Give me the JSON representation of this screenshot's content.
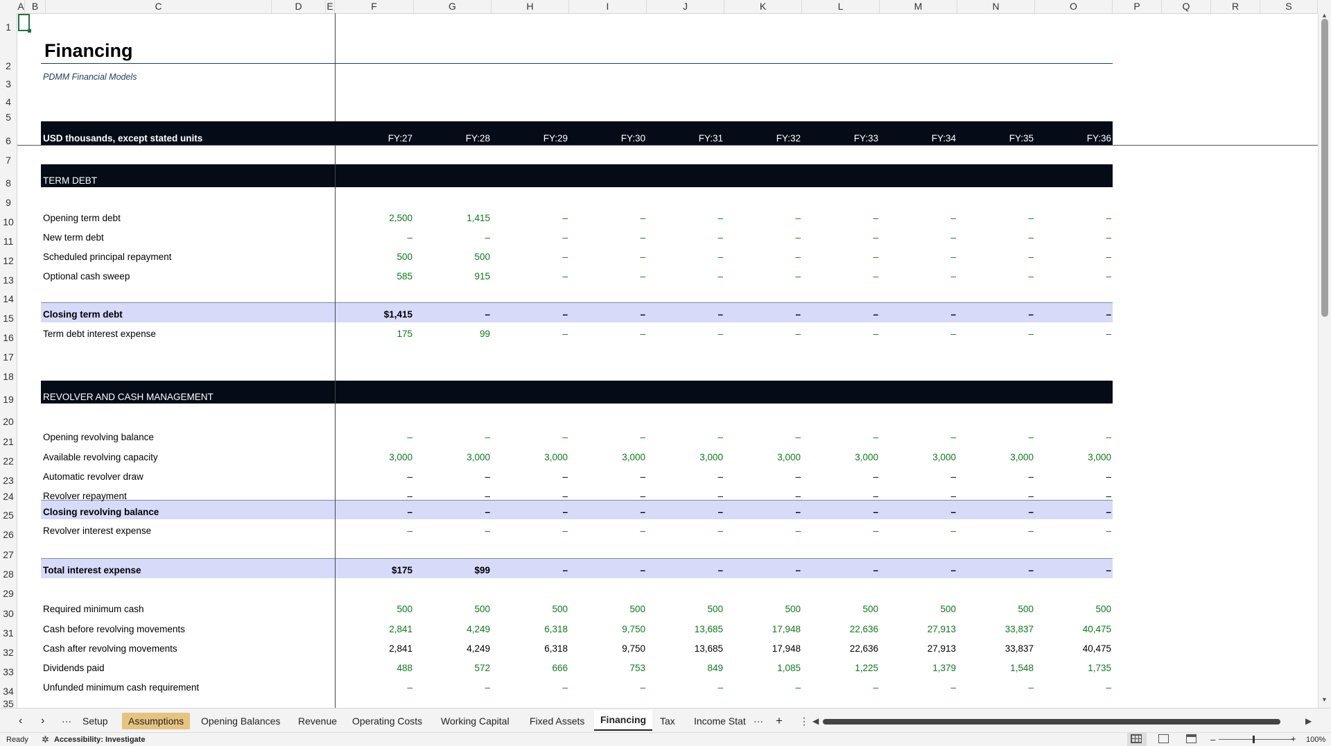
{
  "columns": [
    "A",
    "B",
    "C",
    "D",
    "E",
    "F",
    "G",
    "H",
    "I",
    "J",
    "K",
    "L",
    "M",
    "N",
    "O",
    "P",
    "Q",
    "R",
    "S"
  ],
  "rows": [
    "1",
    "2",
    "3",
    "4",
    "5",
    "6",
    "7",
    "8",
    "9",
    "10",
    "11",
    "12",
    "13",
    "14",
    "15",
    "16",
    "17",
    "18",
    "19",
    "20",
    "21",
    "22",
    "23",
    "24",
    "25",
    "26",
    "27",
    "28",
    "29",
    "30",
    "31",
    "32",
    "33",
    "34",
    "35"
  ],
  "sheet": {
    "title": "Financing",
    "subtitle": "PDMM Financial Models",
    "units_label": "USD thousands, except stated units",
    "periods": [
      "FY:27",
      "FY:28",
      "FY:29",
      "FY:30",
      "FY:31",
      "FY:32",
      "FY:33",
      "FY:34",
      "FY:35",
      "FY:36"
    ],
    "sections": {
      "term_debt": "TERM DEBT",
      "revolver": "REVOLVER AND CASH MANAGEMENT"
    },
    "lines": [
      {
        "label": "Opening term debt",
        "values": [
          "2,500",
          "1,415",
          "–",
          "–",
          "–",
          "–",
          "–",
          "–",
          "–",
          "–"
        ]
      },
      {
        "label": "New term debt",
        "values": [
          "–",
          "–",
          "–",
          "–",
          "–",
          "–",
          "–",
          "–",
          "–",
          "–"
        ]
      },
      {
        "label": "Scheduled principal repayment",
        "values": [
          "500",
          "500",
          "–",
          "–",
          "–",
          "–",
          "–",
          "–",
          "–",
          "–"
        ]
      },
      {
        "label": "Optional cash sweep",
        "values": [
          "585",
          "915",
          "–",
          "–",
          "–",
          "–",
          "–",
          "–",
          "–",
          "–"
        ]
      },
      {
        "label": "Closing term debt",
        "values": [
          "$1,415",
          "–",
          "–",
          "–",
          "–",
          "–",
          "–",
          "–",
          "–",
          "–"
        ]
      },
      {
        "label": "Term debt interest expense",
        "values": [
          "175",
          "99",
          "–",
          "–",
          "–",
          "–",
          "–",
          "–",
          "–",
          "–"
        ]
      },
      {
        "label": "Opening revolving balance",
        "values": [
          "–",
          "–",
          "–",
          "–",
          "–",
          "–",
          "–",
          "–",
          "–",
          "–"
        ]
      },
      {
        "label": "Available revolving capacity",
        "values": [
          "3,000",
          "3,000",
          "3,000",
          "3,000",
          "3,000",
          "3,000",
          "3,000",
          "3,000",
          "3,000",
          "3,000"
        ]
      },
      {
        "label": "Automatic revolver draw",
        "values": [
          "–",
          "–",
          "–",
          "–",
          "–",
          "–",
          "–",
          "–",
          "–",
          "–"
        ]
      },
      {
        "label": "Revolver repayment",
        "values": [
          "–",
          "–",
          "–",
          "–",
          "–",
          "–",
          "–",
          "–",
          "–",
          "–"
        ]
      },
      {
        "label": "Closing revolving balance",
        "values": [
          "–",
          "–",
          "–",
          "–",
          "–",
          "–",
          "–",
          "–",
          "–",
          "–"
        ]
      },
      {
        "label": "Revolver interest expense",
        "values": [
          "–",
          "–",
          "–",
          "–",
          "–",
          "–",
          "–",
          "–",
          "–",
          "–"
        ]
      },
      {
        "label": "Total interest expense",
        "values": [
          "$175",
          "$99",
          "–",
          "–",
          "–",
          "–",
          "–",
          "–",
          "–",
          "–"
        ]
      },
      {
        "label": "Required minimum cash",
        "values": [
          "500",
          "500",
          "500",
          "500",
          "500",
          "500",
          "500",
          "500",
          "500",
          "500"
        ]
      },
      {
        "label": "Cash before revolving movements",
        "values": [
          "2,841",
          "4,249",
          "6,318",
          "9,750",
          "13,685",
          "17,948",
          "22,636",
          "27,913",
          "33,837",
          "40,475"
        ]
      },
      {
        "label": "Cash after revolving movements",
        "values": [
          "2,841",
          "4,249",
          "6,318",
          "9,750",
          "13,685",
          "17,948",
          "22,636",
          "27,913",
          "33,837",
          "40,475"
        ]
      },
      {
        "label": "Dividends paid",
        "values": [
          "488",
          "572",
          "666",
          "753",
          "849",
          "1,085",
          "1,225",
          "1,379",
          "1,548",
          "1,735"
        ]
      },
      {
        "label": "Unfunded minimum cash requirement",
        "values": [
          "–",
          "–",
          "–",
          "–",
          "–",
          "–",
          "–",
          "–",
          "–",
          "–"
        ]
      }
    ]
  },
  "tabs": {
    "nav_prev": "‹",
    "nav_next": "›",
    "nav_more": "···",
    "items": [
      "Setup",
      "Assumptions",
      "Opening Balances",
      "Revenue",
      "Operating Costs",
      "Working Capital",
      "Fixed Assets",
      "Financing",
      "Tax",
      "Income Stat"
    ],
    "active": "Financing",
    "highlighted": "Assumptions",
    "overflow": "···",
    "add": "+",
    "options": "⋮"
  },
  "status": {
    "ready": "Ready",
    "accessibility": "Accessibility: Investigate",
    "zoom": "100%",
    "zoom_minus": "–",
    "zoom_plus": "+"
  },
  "colors": {
    "input_green": "#0a7a1a",
    "dark_band": "#050b17",
    "total_band": "#d8dafa",
    "assumptions_tab": "#e6c480"
  }
}
